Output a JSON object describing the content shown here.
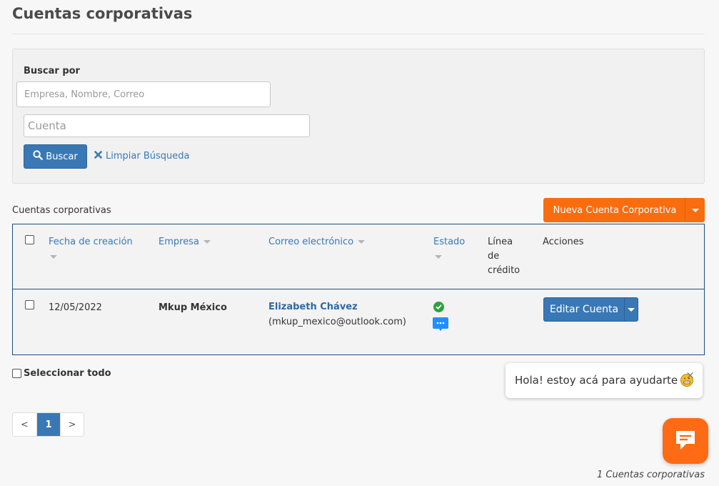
{
  "page": {
    "title": "Cuentas corporativas"
  },
  "search": {
    "label": "Buscar por",
    "main_placeholder": "Empresa, Nombre, Correo",
    "main_value": "",
    "account_placeholder": "Cuenta",
    "account_value": "",
    "search_button": "Buscar",
    "clear_link": "Limpiar Búsqueda"
  },
  "section": {
    "label": "Cuentas corporativas",
    "new_button": "Nueva Cuenta Corporativa"
  },
  "table": {
    "headers": {
      "created": "Fecha de creación",
      "company": "Empresa",
      "email": "Correo electrónico",
      "status": "Estado",
      "credit_line_1": "Línea",
      "credit_line_2": "de",
      "credit_line_3": "crédito",
      "actions": "Acciones"
    },
    "rows": [
      {
        "created": "12/05/2022",
        "company": "Mkup México",
        "contact_name": "Elizabeth Chávez",
        "contact_email": "(mkup_mexico@outlook.com)",
        "credit_line": "",
        "action": "Editar Cuenta"
      }
    ]
  },
  "select_all": "Seleccionar todo",
  "pagination": {
    "prev": "<",
    "current": "1",
    "next": ">"
  },
  "chat": {
    "message": "Hola! estoy acá para ayudarte",
    "close": "×"
  },
  "footer": {
    "count": "1 Cuentas corporativas"
  },
  "colors": {
    "primary": "#3a78b5",
    "accent": "#f96d0f",
    "status_ok": "#2ea043",
    "chat_blue": "#1e90ff",
    "chat_orange": "#ff6a14"
  },
  "icons": {
    "search": "search-icon",
    "clear": "close-icon",
    "status": "check-circle-icon",
    "chat_status": "chat-bubble-icon",
    "emoji": "grinning-emoji-icon",
    "launcher": "chat-icon"
  }
}
